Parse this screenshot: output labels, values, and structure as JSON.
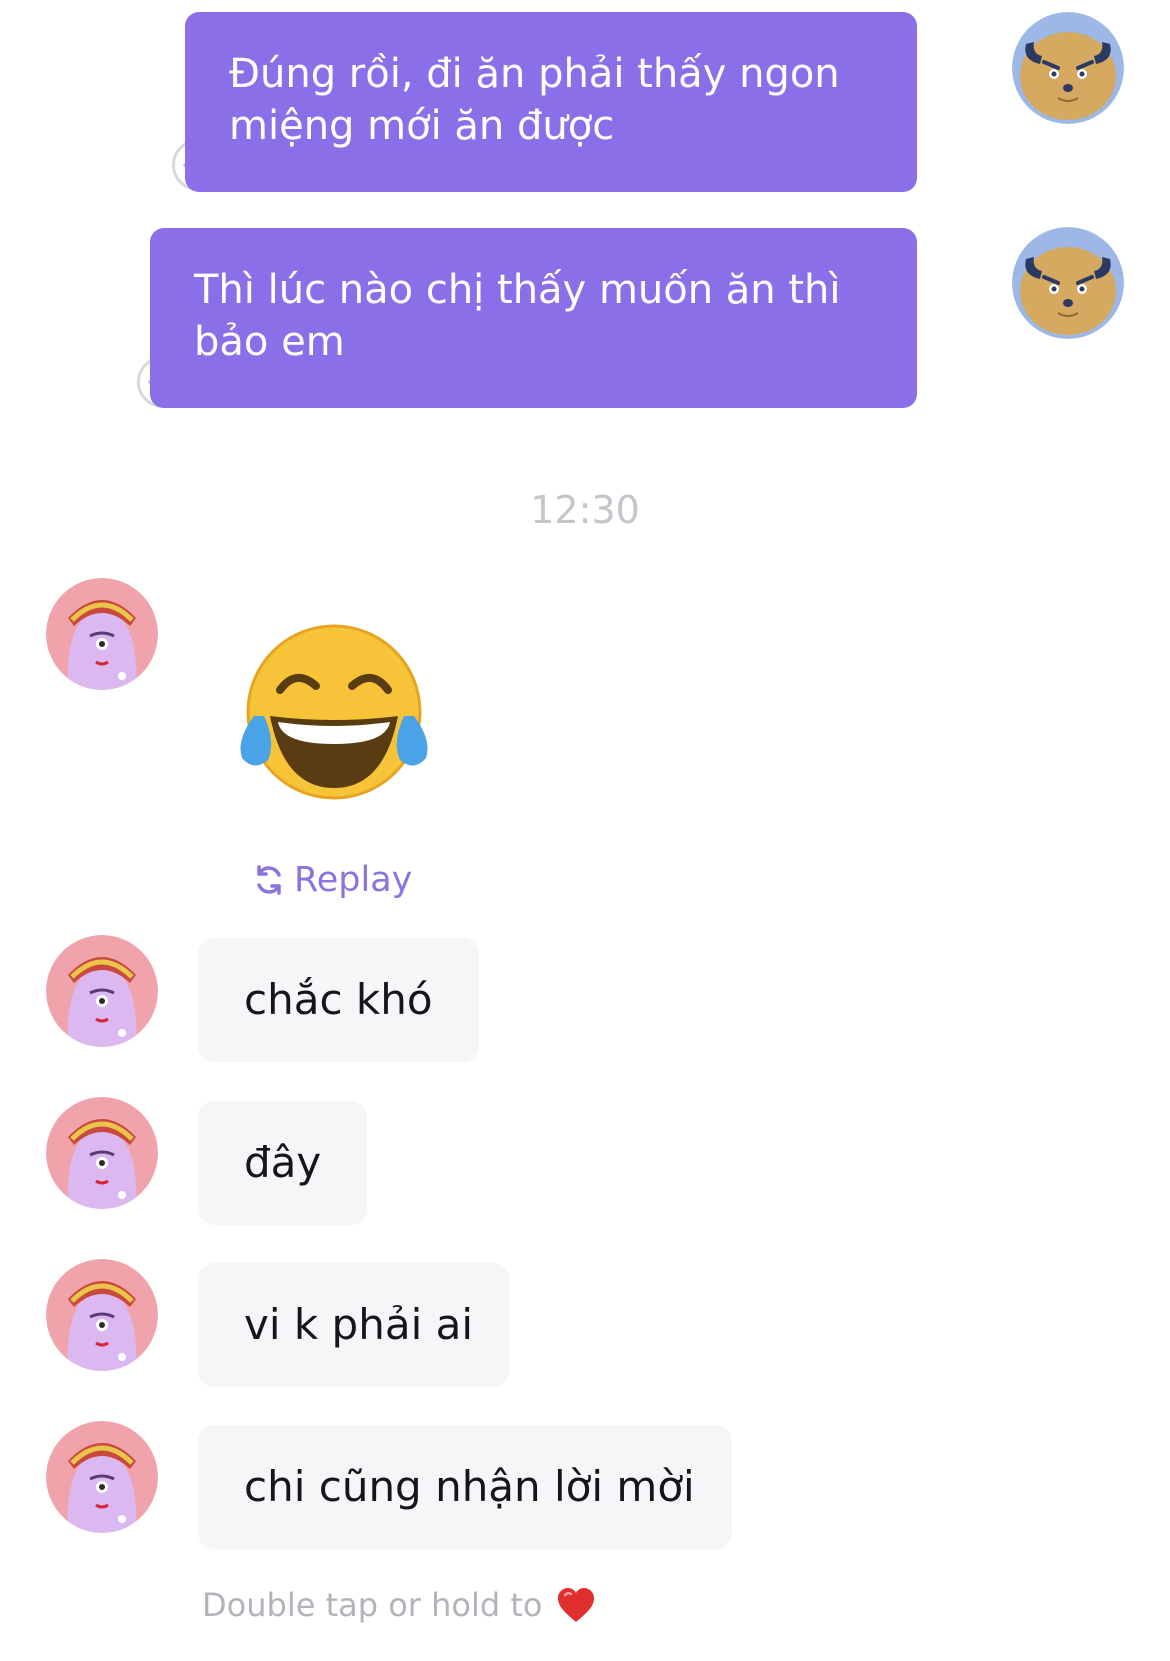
{
  "messages_outgoing": [
    {
      "text": "Đúng rồi, đi ăn phải thấy ngon miệng mới ăn được"
    },
    {
      "text": "Thì lúc nào chị thấy muốn ăn thì bảo em"
    }
  ],
  "timestamp": "12:30",
  "sticker": {
    "icon": "face-with-tears-of-joy-emoji",
    "replay_label": "Replay",
    "replay_icon": "replay-icon"
  },
  "messages_incoming": [
    {
      "text": "chắc khó"
    },
    {
      "text": "đây"
    },
    {
      "text": "vi k phải ai"
    },
    {
      "text": "chi cũng nhận lời mời"
    }
  ],
  "reaction_hint": {
    "text": "Double tap or hold to",
    "icon": "heart-icon"
  },
  "colors": {
    "outgoing_bubble": "#8a6fe8",
    "incoming_bubble": "#f6f6f8",
    "accent": "#8b73e0",
    "timestamp": "#c5c6cc"
  }
}
